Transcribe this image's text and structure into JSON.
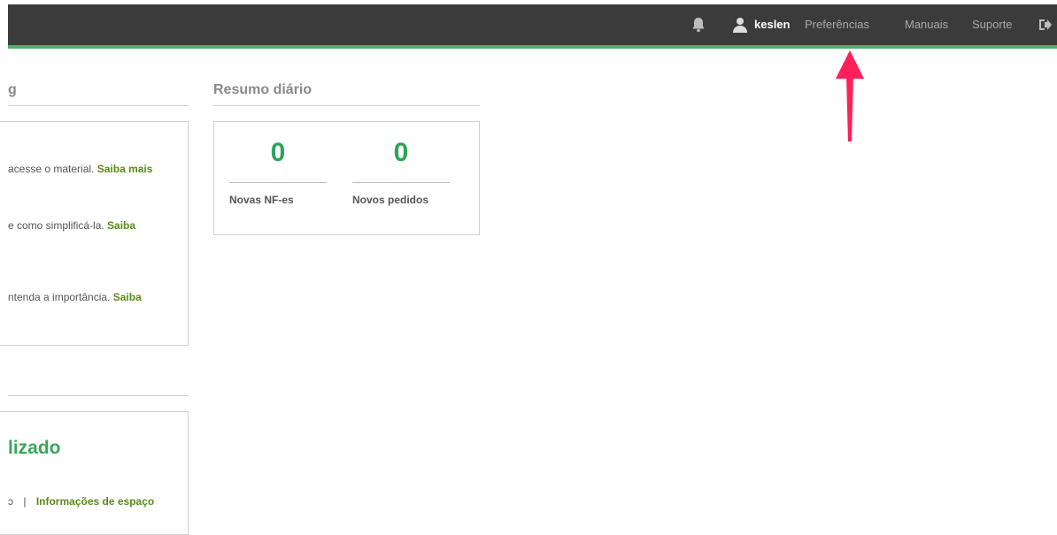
{
  "topbar": {
    "username": "keslen",
    "nav": [
      "Preferências",
      "Manuais",
      "Suporte"
    ],
    "icons": [
      "bell-icon",
      "user-icon",
      "logout-icon"
    ]
  },
  "marketing": {
    "title_fragment": "g",
    "items": [
      {
        "text": "acesse o material.",
        "link": "Saiba mais"
      },
      {
        "text": "e como simplificá-la.",
        "link": "Saiba"
      },
      {
        "text": "ntenda a importância.",
        "link": "Saiba"
      }
    ]
  },
  "resumo": {
    "title": "Resumo diário",
    "stats": [
      {
        "value": "0",
        "label": "Novas NF-es"
      },
      {
        "value": "0",
        "label": "Novos pedidos"
      }
    ]
  },
  "storage": {
    "heading_fragment": "lizado",
    "left_fragment": "ɔ",
    "separator": "|",
    "link": "Informações de espaço"
  },
  "annotation": {
    "arrow_color": "#ff1f5a"
  },
  "colors": {
    "topbar": "#3b3b3b",
    "accent": "#4caf6d",
    "stat": "#2ea35a",
    "link": "#5b8a1a"
  }
}
